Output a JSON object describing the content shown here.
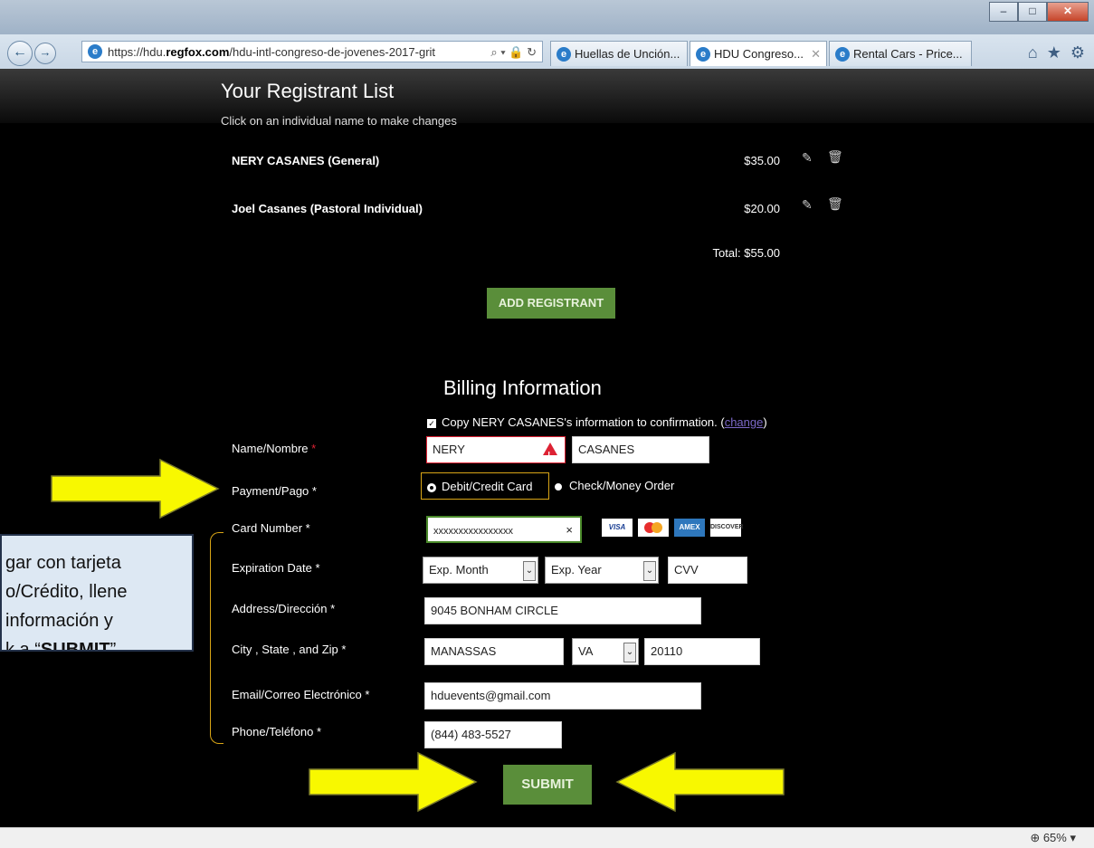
{
  "browser": {
    "url_host": "https://hdu.",
    "url_domain": "regfox.com",
    "url_path": "/hdu-intl-congreso-de-jovenes-2017-grit",
    "tabs": [
      {
        "label": "Huellas de Unción..."
      },
      {
        "label": "HDU Congreso..."
      },
      {
        "label": "Rental Cars - Price..."
      }
    ],
    "zoom": "65%"
  },
  "registrants": {
    "title": "Your Registrant List",
    "subtitle": "Click on an individual name to make changes",
    "rows": [
      {
        "name": "NERY CASANES (General)",
        "price": "$35.00"
      },
      {
        "name": "Joel Casanes (Pastoral Individual)",
        "price": "$20.00"
      }
    ],
    "total": "Total: $55.00",
    "add_button": "ADD REGISTRANT"
  },
  "billing": {
    "title": "Billing Information",
    "copy_text": "Copy NERY CASANES's information to confirmation.",
    "copy_link": "change",
    "labels": {
      "name": "Name/Nombre",
      "payment": "Payment/Pago",
      "card": "Card Number",
      "expiration": "Expiration Date",
      "address": "Address/Dirección",
      "city": "City , State , and Zip",
      "email": "Email/Correo Electrónico",
      "phone": "Phone/Teléfono"
    },
    "required_mark": "*",
    "first_name": "NERY",
    "last_name": "CASANES",
    "payment_options": [
      "Debit/Credit Card",
      "Check/Money Order"
    ],
    "card_number": "xxxxxxxxxxxxxxxx",
    "card_clear": "×",
    "cards": [
      "VISA",
      "MC",
      "AMEX",
      "DISCOVER"
    ],
    "exp_month": "Exp. Month",
    "exp_year": "Exp. Year",
    "cvv_placeholder": "CVV",
    "address": "9045 BONHAM CIRCLE",
    "city": "MANASSAS",
    "state": "VA",
    "zip": "20110",
    "email": "hduevents@gmail.com",
    "phone": "(844) 483-5527",
    "submit": "SUBMIT"
  },
  "callout": {
    "line1": "gar con tarjeta",
    "line2": "o/Crédito, llene",
    "line3": "información y",
    "line4_prefix": "k a “",
    "line4_bold": "SUBMIT",
    "line4_suffix": "”"
  }
}
